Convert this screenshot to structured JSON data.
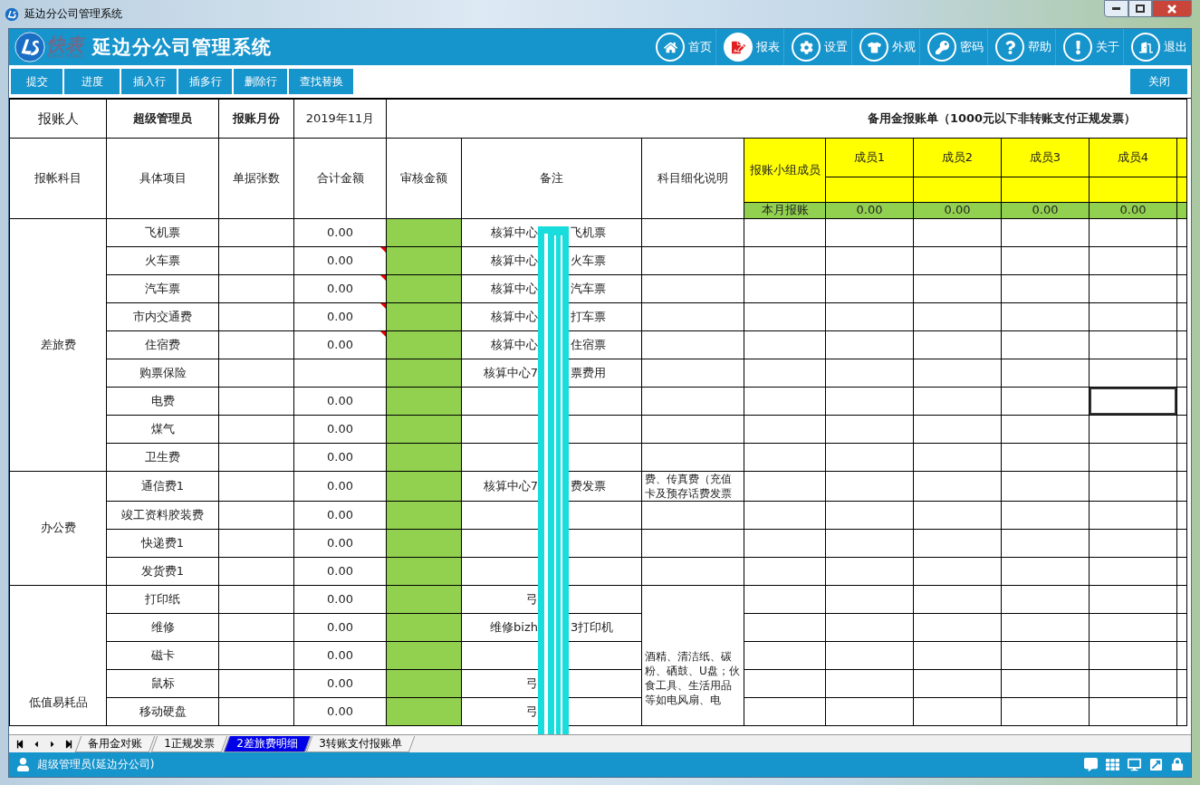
{
  "window": {
    "title": "延边分公司管理系统"
  },
  "header": {
    "logo": {
      "name": "快表",
      "tagline": "KUAI BIAO"
    },
    "title": "延边分公司管理系统",
    "nav": [
      {
        "label": "首页",
        "selected": false
      },
      {
        "label": "报表",
        "selected": true
      },
      {
        "label": "设置",
        "selected": false
      },
      {
        "label": "外观",
        "selected": false
      },
      {
        "label": "密码",
        "selected": false
      },
      {
        "label": "帮助",
        "selected": false
      },
      {
        "label": "关于",
        "selected": false
      },
      {
        "label": "退出",
        "selected": false
      }
    ]
  },
  "toolbar": {
    "buttons": [
      "提交",
      "进度",
      "插入行",
      "插多行",
      "删除行",
      "查找替换"
    ],
    "close": "关闭"
  },
  "sheet": {
    "info": [
      {
        "text": "报账人",
        "bold": false
      },
      {
        "text": "超级管理员",
        "bold": true
      },
      {
        "text": "报账月份",
        "bold": true
      },
      {
        "text": "2019年11月",
        "bold": false
      }
    ],
    "title": "备用金报账单（1000元以下非转账支付正规发票）",
    "columns": [
      "报帐科目",
      "具体项目",
      "单据张数",
      "合计金额",
      "审核金额",
      "备注",
      "科目细化说明"
    ],
    "member_header": "报账小组成员",
    "members": [
      "成员1",
      "成员2",
      "成员3",
      "成员4"
    ],
    "month_label": "本月报账",
    "month_totals": [
      "0.00",
      "0.00",
      "0.00",
      "0.00"
    ],
    "groups": [
      {
        "name": "差旅费",
        "rows": [
          {
            "item": "飞机票",
            "amount": "0.00",
            "note_left": "核算中心",
            "note_right": "飞机票",
            "comment": false,
            "selected": false
          },
          {
            "item": "火车票",
            "amount": "0.00",
            "note_left": "核算中心",
            "note_right": "火车票",
            "comment": true,
            "selected": false
          },
          {
            "item": "汽车票",
            "amount": "0.00",
            "note_left": "核算中心",
            "note_right": "汽车票",
            "comment": true,
            "selected": false
          },
          {
            "item": "市内交通费",
            "amount": "0.00",
            "note_left": "核算中心",
            "note_right": "打车票",
            "comment": true,
            "selected": false
          },
          {
            "item": "住宿费",
            "amount": "0.00",
            "note_left": "核算中心",
            "note_right": "住宿票",
            "comment": true,
            "selected": false
          },
          {
            "item": "购票保险",
            "note_left": "核算中心7",
            "note_right": "票费用",
            "comment": false,
            "selected": false
          },
          {
            "item": "电费",
            "amount": "0.00",
            "comment": false,
            "selected": true
          },
          {
            "item": "煤气",
            "amount": "0.00",
            "comment": false,
            "selected": false
          },
          {
            "item": "卫生费",
            "amount": "0.00",
            "comment": false,
            "selected": false
          }
        ]
      },
      {
        "name": "办公费",
        "rows": [
          {
            "item": "通信费1",
            "amount": "0.00",
            "note_left": "核算中心7",
            "note_right": "费发票",
            "detail": "费、传真费（充值卡及预存话费发票",
            "comment": false,
            "selected": false
          },
          {
            "item": "竣工资料胶装费",
            "amount": "0.00",
            "comment": false,
            "selected": false
          },
          {
            "item": "快递费1",
            "amount": "0.00",
            "comment": false,
            "selected": false
          },
          {
            "item": "发货费1",
            "amount": "0.00",
            "comment": false,
            "selected": false
          }
        ]
      },
      {
        "name": "低值易耗品",
        "detail": "酒精、清洁纸、碳粉、硒鼓、U盘；伙食工具、生活用品等如电风扇、电",
        "rows": [
          {
            "item": "打印纸",
            "amount": "0.00",
            "note_left": "弓",
            "comment": false,
            "selected": false
          },
          {
            "item": "维修",
            "amount": "0.00",
            "note_left": "维修bizh",
            "note_right": "3打印机",
            "comment": false,
            "selected": false
          },
          {
            "item": "磁卡",
            "amount": "0.00",
            "comment": false,
            "selected": false
          },
          {
            "item": "鼠标",
            "amount": "0.00",
            "note_left": "弓",
            "comment": false,
            "selected": false
          },
          {
            "item": "移动硬盘",
            "amount": "0.00",
            "note_left": "弓",
            "comment": false,
            "selected": false
          }
        ]
      }
    ]
  },
  "sheet_tabs": [
    {
      "label": "备用金对账",
      "selected": false
    },
    {
      "label": "1正规发票",
      "selected": false
    },
    {
      "label": "2差旅费明细",
      "selected": true
    },
    {
      "label": "3转账支付报账单",
      "selected": false
    }
  ],
  "status_bar": {
    "user": "超级管理员(延边分公司)"
  }
}
